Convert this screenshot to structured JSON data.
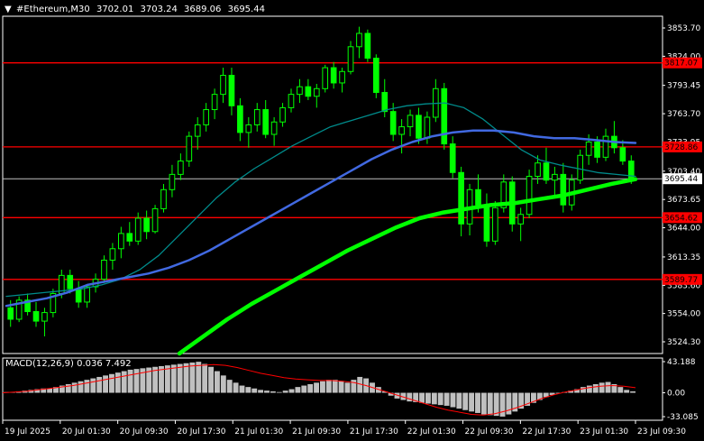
{
  "header": {
    "arrow_icon": "triangle-down-icon",
    "symbol_tf": "#Ethereum,M30",
    "o": "3702.01",
    "h": "3703.24",
    "l": "3689.06",
    "c": "3695.44"
  },
  "colors": {
    "background": "#000000",
    "candle": "#00ff00",
    "level": "#ff0000",
    "ma_fast": "#008b8b",
    "ma_mid": "#4169e1",
    "ma_slow": "#00ff00",
    "macd_hist": "#c0c0c0",
    "macd_signal": "#ff0000"
  },
  "chart_data": [
    {
      "type": "line",
      "subtype": "candlestick",
      "title": "#Ethereum,M30",
      "price_axis": {
        "ticks": [
          "3853.70",
          "3824.00",
          "3793.45",
          "3763.70",
          "3733.95",
          "3703.40",
          "3673.65",
          "3644.00",
          "3613.35",
          "3583.60",
          "3554.00",
          "3524.30"
        ],
        "ylim": [
          3512,
          3866
        ]
      },
      "time_axis": {
        "ticks": [
          "19 Jul 2025",
          "20 Jul 01:30",
          "20 Jul 09:30",
          "20 Jul 17:30",
          "21 Jul 01:30",
          "21 Jul 09:30",
          "21 Jul 17:30",
          "22 Jul 01:30",
          "22 Jul 09:30",
          "22 Jul 17:30",
          "23 Jul 01:30",
          "23 Jul 09:30"
        ]
      },
      "levels": [
        {
          "price": 3817.07,
          "label": "3817.07"
        },
        {
          "price": 3728.86,
          "label": "3728.86"
        },
        {
          "price": 3654.62,
          "label": "3654.62"
        },
        {
          "price": 3589.77,
          "label": "3589.77"
        }
      ],
      "current_price": {
        "price": 3695.44,
        "label": "3695.44"
      },
      "candles": [
        [
          3560,
          3568,
          3540,
          3548
        ],
        [
          3548,
          3572,
          3545,
          3568
        ],
        [
          3568,
          3575,
          3552,
          3556
        ],
        [
          3556,
          3566,
          3540,
          3546
        ],
        [
          3546,
          3560,
          3530,
          3555
        ],
        [
          3555,
          3580,
          3550,
          3575
        ],
        [
          3575,
          3600,
          3570,
          3594
        ],
        [
          3594,
          3600,
          3575,
          3580
        ],
        [
          3580,
          3588,
          3560,
          3566
        ],
        [
          3566,
          3585,
          3560,
          3582
        ],
        [
          3582,
          3596,
          3576,
          3590
        ],
        [
          3590,
          3615,
          3586,
          3610
        ],
        [
          3610,
          3628,
          3600,
          3622
        ],
        [
          3622,
          3645,
          3612,
          3638
        ],
        [
          3638,
          3650,
          3625,
          3630
        ],
        [
          3630,
          3660,
          3626,
          3654
        ],
        [
          3654,
          3662,
          3632,
          3640
        ],
        [
          3640,
          3668,
          3638,
          3664
        ],
        [
          3664,
          3690,
          3660,
          3684
        ],
        [
          3684,
          3710,
          3676,
          3700
        ],
        [
          3700,
          3722,
          3694,
          3714
        ],
        [
          3714,
          3745,
          3708,
          3740
        ],
        [
          3740,
          3760,
          3726,
          3752
        ],
        [
          3752,
          3775,
          3745,
          3768
        ],
        [
          3768,
          3790,
          3758,
          3784
        ],
        [
          3784,
          3812,
          3775,
          3804
        ],
        [
          3804,
          3812,
          3762,
          3772
        ],
        [
          3772,
          3780,
          3735,
          3744
        ],
        [
          3744,
          3760,
          3728,
          3752
        ],
        [
          3752,
          3775,
          3745,
          3768
        ],
        [
          3768,
          3778,
          3738,
          3742
        ],
        [
          3742,
          3760,
          3730,
          3755
        ],
        [
          3755,
          3775,
          3750,
          3770
        ],
        [
          3770,
          3790,
          3765,
          3784
        ],
        [
          3784,
          3800,
          3775,
          3792
        ],
        [
          3792,
          3800,
          3778,
          3782
        ],
        [
          3782,
          3795,
          3770,
          3790
        ],
        [
          3790,
          3815,
          3786,
          3812
        ],
        [
          3812,
          3818,
          3790,
          3796
        ],
        [
          3796,
          3812,
          3786,
          3808
        ],
        [
          3808,
          3840,
          3805,
          3834
        ],
        [
          3834,
          3855,
          3822,
          3848
        ],
        [
          3848,
          3852,
          3818,
          3822
        ],
        [
          3822,
          3826,
          3780,
          3786
        ],
        [
          3786,
          3800,
          3760,
          3766
        ],
        [
          3766,
          3775,
          3735,
          3742
        ],
        [
          3742,
          3758,
          3722,
          3750
        ],
        [
          3750,
          3768,
          3740,
          3762
        ],
        [
          3762,
          3770,
          3732,
          3738
        ],
        [
          3738,
          3766,
          3732,
          3760
        ],
        [
          3760,
          3800,
          3755,
          3790
        ],
        [
          3790,
          3796,
          3726,
          3732
        ],
        [
          3732,
          3740,
          3696,
          3702
        ],
        [
          3702,
          3708,
          3635,
          3648
        ],
        [
          3648,
          3690,
          3636,
          3684
        ],
        [
          3684,
          3700,
          3660,
          3668
        ],
        [
          3668,
          3680,
          3624,
          3630
        ],
        [
          3630,
          3672,
          3626,
          3665
        ],
        [
          3665,
          3700,
          3660,
          3692
        ],
        [
          3692,
          3698,
          3640,
          3648
        ],
        [
          3648,
          3665,
          3630,
          3658
        ],
        [
          3658,
          3705,
          3654,
          3698
        ],
        [
          3698,
          3720,
          3690,
          3712
        ],
        [
          3712,
          3728,
          3690,
          3694
        ],
        [
          3694,
          3708,
          3676,
          3700
        ],
        [
          3700,
          3712,
          3660,
          3668
        ],
        [
          3668,
          3700,
          3662,
          3694
        ],
        [
          3694,
          3726,
          3690,
          3720
        ],
        [
          3720,
          3742,
          3710,
          3734
        ],
        [
          3734,
          3740,
          3712,
          3718
        ],
        [
          3718,
          3748,
          3714,
          3740
        ],
        [
          3740,
          3756,
          3722,
          3728
        ],
        [
          3728,
          3736,
          3710,
          3714
        ],
        [
          3714,
          3720,
          3690,
          3695
        ]
      ],
      "ma_fast": [
        3572,
        3574,
        3576,
        3578,
        3580,
        3584,
        3590,
        3600,
        3615,
        3635,
        3655,
        3675,
        3692,
        3706,
        3718,
        3730,
        3740,
        3750,
        3756,
        3762,
        3768,
        3772,
        3774,
        3775,
        3770,
        3758,
        3742,
        3726,
        3715,
        3710,
        3706,
        3702,
        3700,
        3698
      ],
      "ma_mid": [
        3562,
        3566,
        3570,
        3576,
        3584,
        3588,
        3592,
        3596,
        3602,
        3610,
        3620,
        3632,
        3644,
        3656,
        3668,
        3680,
        3692,
        3704,
        3716,
        3726,
        3734,
        3740,
        3744,
        3746,
        3746,
        3744,
        3740,
        3738,
        3738,
        3736,
        3734,
        3733
      ],
      "ma_slow": [
        3512,
        3530,
        3548,
        3564,
        3578,
        3592,
        3606,
        3620,
        3632,
        3644,
        3654,
        3660,
        3664,
        3668,
        3670,
        3674,
        3678,
        3684,
        3690,
        3695
      ]
    },
    {
      "type": "bar",
      "title": "MACD(12,26,9)",
      "main_value": "0.036",
      "signal_value": "7.492",
      "label": "MACD(12,26,9) 0.036 7.492",
      "y_ticks": [
        "43.188",
        "0.00",
        "-33.085"
      ],
      "ylim": [
        -33.085,
        43.188
      ],
      "histogram": [
        1,
        1,
        2,
        3,
        4,
        5,
        6,
        6,
        8,
        10,
        12,
        14,
        16,
        18,
        20,
        22,
        24,
        26,
        28,
        30,
        32,
        33,
        34,
        35,
        36,
        37,
        38,
        39,
        40,
        41,
        42,
        43,
        40,
        36,
        30,
        24,
        18,
        14,
        10,
        8,
        6,
        4,
        3,
        2,
        1,
        3,
        5,
        8,
        10,
        12,
        14,
        16,
        18,
        18,
        16,
        14,
        18,
        22,
        20,
        14,
        8,
        2,
        -4,
        -8,
        -10,
        -12,
        -13,
        -14,
        -15,
        -16,
        -17,
        -18,
        -20,
        -22,
        -24,
        -26,
        -28,
        -30,
        -31,
        -32,
        -33,
        -30,
        -26,
        -22,
        -18,
        -14,
        -10,
        -6,
        -3,
        -1,
        1,
        3,
        5,
        8,
        10,
        12,
        14,
        15,
        12,
        8,
        4,
        2
      ],
      "signal": [
        0,
        1,
        2,
        4,
        6,
        8,
        10,
        13,
        16,
        19,
        22,
        25,
        28,
        31,
        33,
        35,
        37,
        38,
        39,
        38,
        35,
        31,
        27,
        24,
        21,
        19,
        18,
        17,
        17,
        16,
        14,
        10,
        5,
        0,
        -5,
        -10,
        -15,
        -20,
        -24,
        -27,
        -30,
        -31,
        -29,
        -25,
        -20,
        -14,
        -8,
        -3,
        1,
        4,
        7,
        9,
        10,
        9,
        7
      ]
    }
  ]
}
